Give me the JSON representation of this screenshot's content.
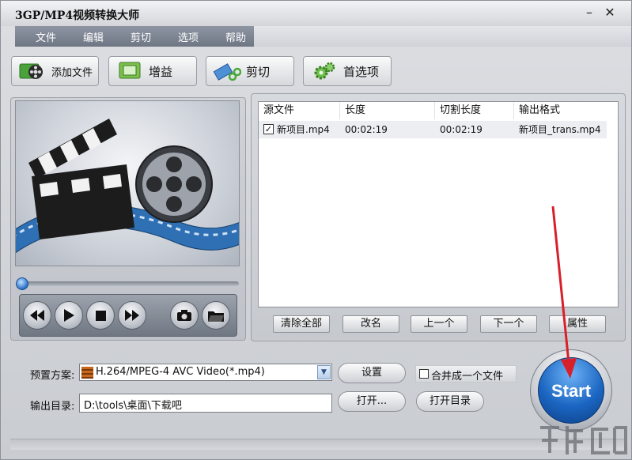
{
  "window": {
    "title": "3GP/MP4视频转换大师"
  },
  "menu": [
    "文件",
    "编辑",
    "剪切",
    "选项",
    "帮助"
  ],
  "toolbar": {
    "add_file": "添加文件",
    "gain": "增益",
    "cut": "剪切",
    "preferences": "首选项"
  },
  "file_list": {
    "columns": [
      "源文件",
      "长度",
      "切割长度",
      "输出格式"
    ],
    "rows": [
      {
        "checked": true,
        "source": "新项目.mp4",
        "length": "00:02:19",
        "cut_length": "00:02:19",
        "output": "新项目_trans.mp4"
      }
    ]
  },
  "list_buttons": {
    "clear_all": "清除全部",
    "rename": "改名",
    "move_up": "上一个",
    "move_down": "下一个",
    "properties": "属性"
  },
  "preset": {
    "label": "预置方案:",
    "value": "H.264/MPEG-4 AVC Video(*.mp4)",
    "settings_button": "设置"
  },
  "merge": {
    "label": "合并成一个文件",
    "checked": false
  },
  "output_dir": {
    "label": "输出目录:",
    "value": "D:\\tools\\桌面\\下载吧",
    "open_button": "打开...",
    "open_dir_button": "打开目录"
  },
  "start_button": "Start",
  "playback": {
    "progress": 0
  },
  "colors": {
    "start_blue": "#1b66c2",
    "annotation_arrow": "#d8202a",
    "menubar": "#7a8190"
  },
  "icons": {
    "minimize": "minimize-icon",
    "close": "close-icon",
    "add_file": "film-reel-add-icon",
    "gain": "monitor-gain-icon",
    "cut": "scissors-film-icon",
    "preferences": "gears-icon"
  }
}
